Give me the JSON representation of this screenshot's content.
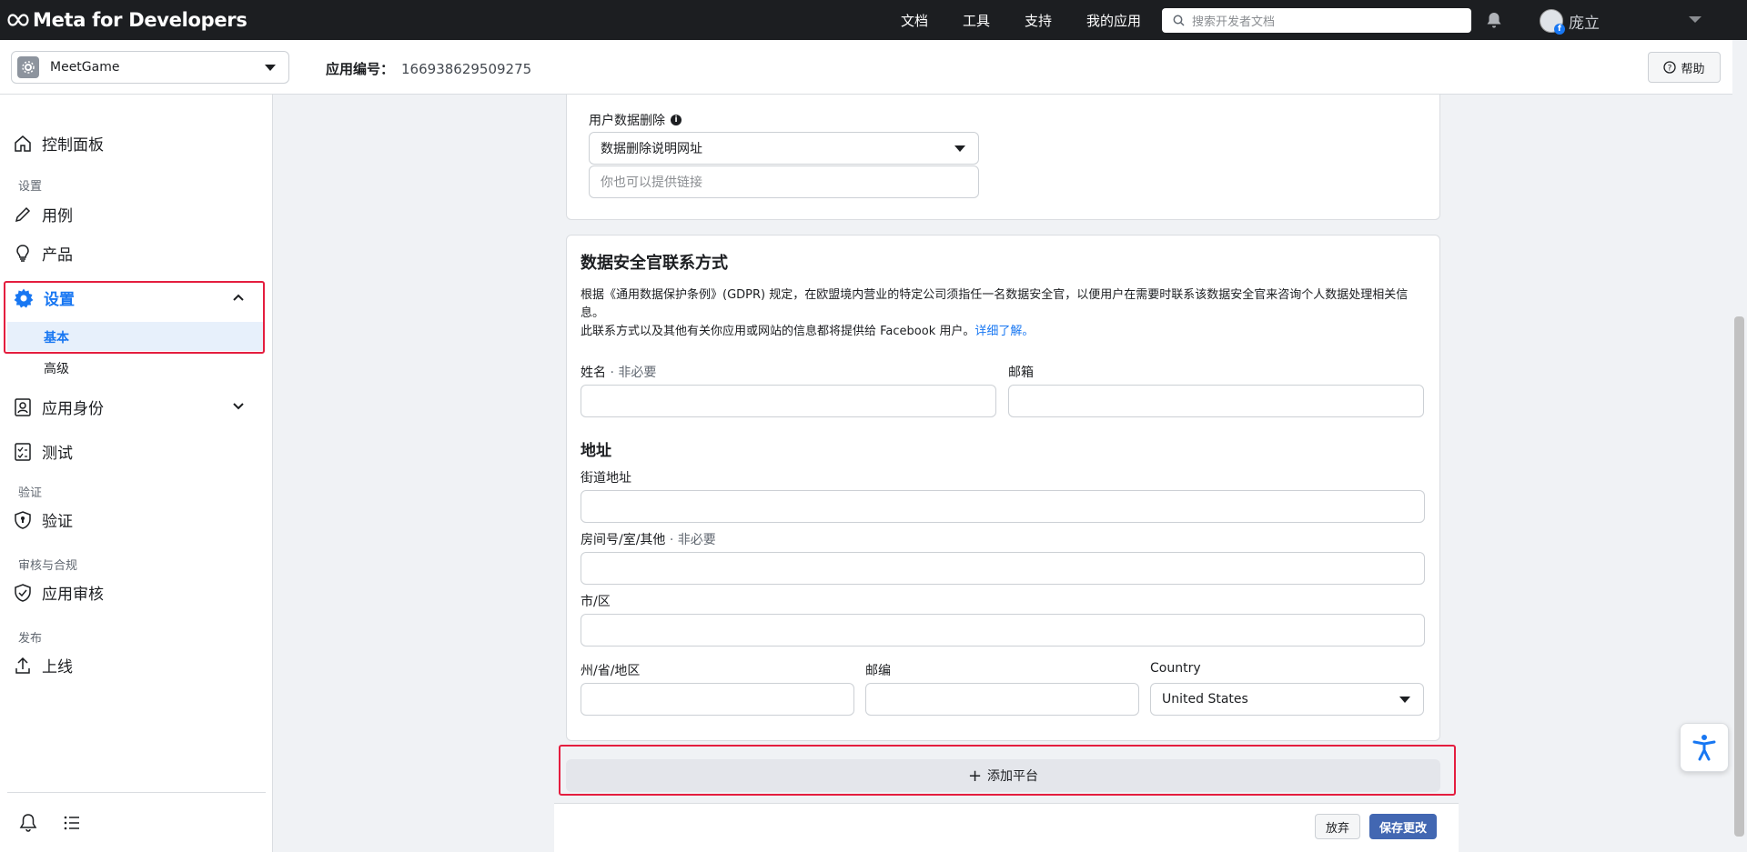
{
  "topbar": {
    "brand": "Meta for Developers",
    "nav": [
      "文档",
      "工具",
      "支持",
      "我的应用"
    ],
    "search_placeholder": "搜索开发者文档",
    "username": "庞立"
  },
  "appbar": {
    "app_name": "MeetGame",
    "app_id_label": "应用编号：",
    "app_id": "166938629509275",
    "help": "帮助"
  },
  "sidebar": {
    "dashboard": "控制面板",
    "section_settings": "设置",
    "use_cases": "用例",
    "products": "产品",
    "settings": "设置",
    "basic": "基本",
    "advanced": "高级",
    "app_roles": "应用身份",
    "testing": "测试",
    "section_verification": "验证",
    "verification": "验证",
    "section_review": "审核与合规",
    "app_review": "应用审核",
    "section_publish": "发布",
    "go_live": "上线"
  },
  "data_deletion": {
    "label": "用户数据删除",
    "select_value": "数据删除说明网址",
    "link_placeholder": "你也可以提供链接"
  },
  "dpo": {
    "title": "数据安全官联系方式",
    "desc1": "根据《通用数据保护条例》(GDPR) 规定，在欧盟境内营业的特定公司须指任一名数据安全官，以便用户在需要时联系该数据安全官来咨询个人数据处理相关信息。",
    "desc2": "此联系方式以及其他有关你应用或网站的信息都将提供给 Facebook 用户。",
    "learn_more": "详细了解。",
    "name_label": "姓名",
    "optional": " · 非必要",
    "email_label": "邮箱",
    "address_title": "地址",
    "street_label": "街道地址",
    "room_label": "房间号/室/其他",
    "city_label": "市/区",
    "state_label": "州/省/地区",
    "zip_label": "邮编",
    "country_label": "Country",
    "country_value": "United States"
  },
  "add_platform": "添加平台",
  "footer": {
    "discard": "放弃",
    "save": "保存更改"
  },
  "colors": {
    "accent": "#1877f2",
    "highlight_border": "#e41e3f",
    "save_button": "#4267b2"
  }
}
